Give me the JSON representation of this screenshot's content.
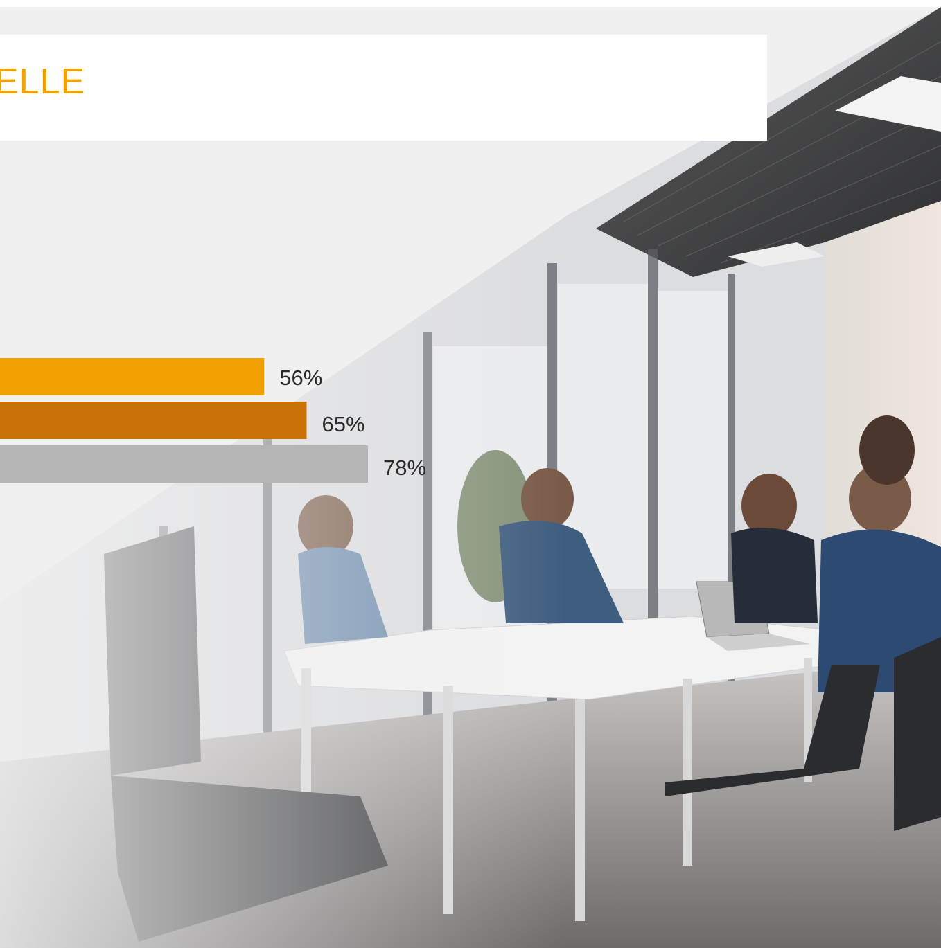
{
  "slide": {
    "title_fragment": "ELLE"
  },
  "chart_data": {
    "type": "bar",
    "orientation": "horizontal",
    "series": [
      {
        "value": 56,
        "label": "56%",
        "color": "#f0a000"
      },
      {
        "value": 65,
        "label": "65%",
        "color": "#c87208"
      },
      {
        "value": 78,
        "label": "78%",
        "color": "#b5b5b5"
      }
    ],
    "xlim": [
      0,
      100
    ],
    "grid": false
  },
  "photo": {
    "description_icon": "office-meeting-photo"
  }
}
